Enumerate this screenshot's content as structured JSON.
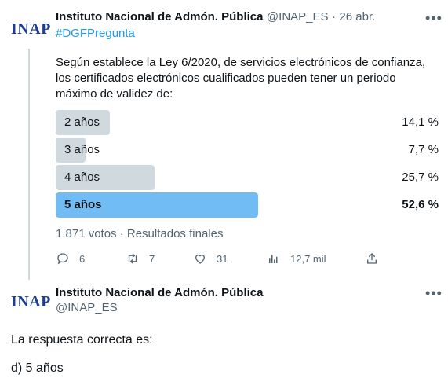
{
  "tweet": {
    "avatar_text": "INAP",
    "author_name": "Instituto Nacional de Admón. Pública",
    "handle": "@INAP_ES",
    "separator": "·",
    "date": "26 abr.",
    "hashtag": "#DGFPregunta",
    "question_lines": [
      "Según establece la Ley 6/2020, de servicios electrónicos de confianza,",
      "los certificados electrónicos cualificados pueden tener un periodo",
      "máximo de validez de:"
    ],
    "poll": {
      "options": [
        {
          "label": "2 años",
          "percent_text": "14,1 %",
          "percent": 14.1,
          "winner": false
        },
        {
          "label": "3 años",
          "percent_text": "7,7 %",
          "percent": 7.7,
          "winner": false
        },
        {
          "label": "4 años",
          "percent_text": "25,7 %",
          "percent": 25.7,
          "winner": false
        },
        {
          "label": "5 años",
          "percent_text": "52,6 %",
          "percent": 52.6,
          "winner": true
        }
      ],
      "footer": "1.871 votos · Resultados finales"
    },
    "actions": {
      "replies": "6",
      "retweets": "7",
      "likes": "31",
      "views": "12,7 mil"
    }
  },
  "reply": {
    "avatar_text": "INAP",
    "author_name": "Instituto Nacional de Admón. Pública",
    "handle": "@INAP_ES",
    "body_line1": "La respuesta correcta es:",
    "body_line2": "d) 5 años"
  },
  "colors": {
    "brand": "#1d3d8f",
    "accent": "#1d9bf0",
    "bar": "#cfd9de",
    "bar_winner": "#72bcf5",
    "muted": "#536471"
  },
  "icons": [
    "reply-icon",
    "retweet-icon",
    "like-icon",
    "views-icon",
    "share-icon",
    "more-icon"
  ]
}
